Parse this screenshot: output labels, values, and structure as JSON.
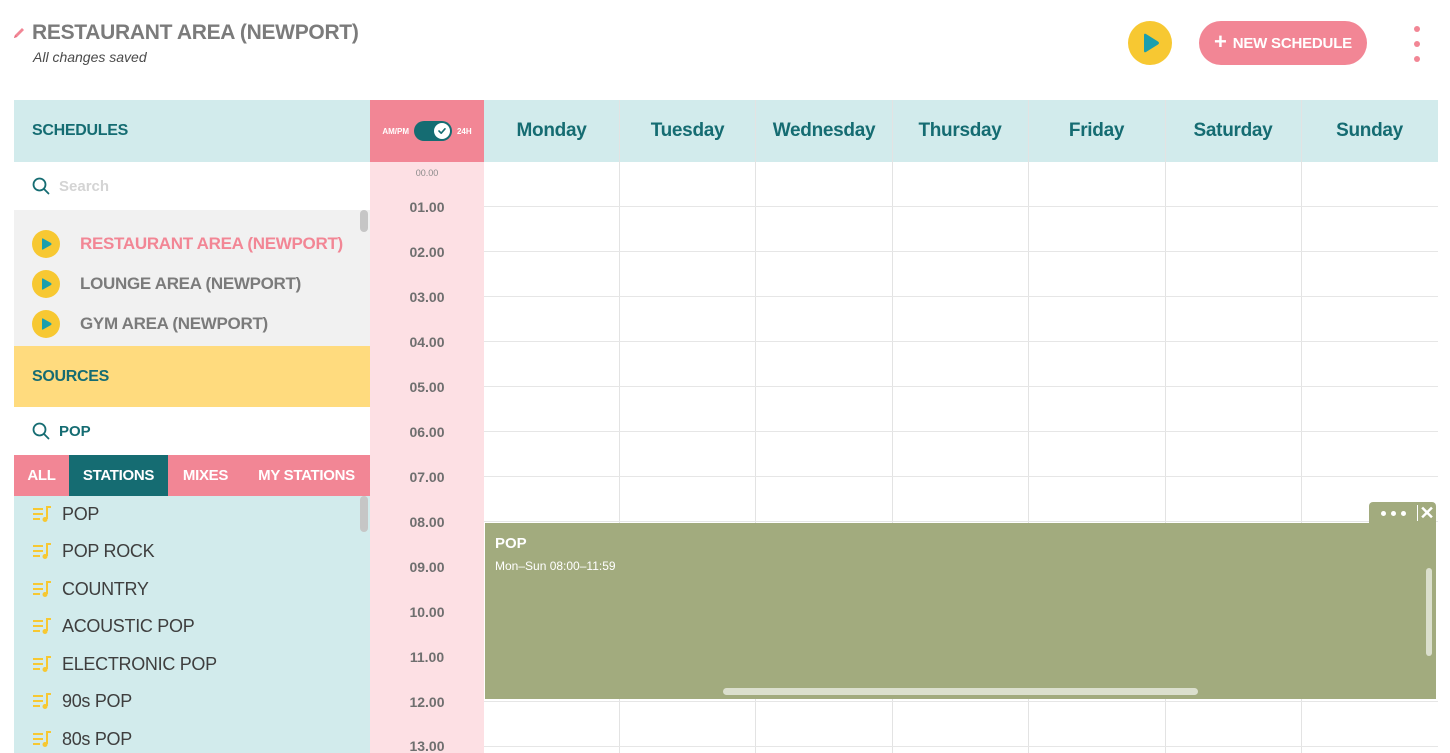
{
  "header": {
    "title": "RESTAURANT AREA (NEWPORT)",
    "status": "All changes saved",
    "new_schedule_label": "NEW SCHEDULE"
  },
  "schedules": {
    "heading": "SCHEDULES",
    "search_placeholder": "Search",
    "items": [
      {
        "label": "RESTAURANT AREA (NEWPORT)",
        "active": true
      },
      {
        "label": "LOUNGE AREA (NEWPORT)",
        "active": false
      },
      {
        "label": "GYM AREA (NEWPORT)",
        "active": false
      }
    ]
  },
  "sources": {
    "heading": "SOURCES",
    "search_value": "POP",
    "tabs": [
      {
        "label": "ALL",
        "selected": false
      },
      {
        "label": "STATIONS",
        "selected": true
      },
      {
        "label": "MIXES",
        "selected": false
      },
      {
        "label": "MY STATIONS",
        "selected": false
      }
    ],
    "stations": [
      "POP",
      "POP ROCK",
      "COUNTRY",
      "ACOUSTIC POP",
      "ELECTRONIC POP",
      "90s POP",
      "80s POP"
    ]
  },
  "time_toggle": {
    "left_label": "AM/PM",
    "right_label": "24H",
    "selected": "24H"
  },
  "hours": [
    "00.00",
    "01.00",
    "02.00",
    "03.00",
    "04.00",
    "05.00",
    "06.00",
    "07.00",
    "08.00",
    "09.00",
    "10.00",
    "11.00",
    "12.00",
    "13.00"
  ],
  "days": [
    "Monday",
    "Tuesday",
    "Wednesday",
    "Thursday",
    "Friday",
    "Saturday",
    "Sunday"
  ],
  "event": {
    "name": "POP",
    "time": "Mon–Sun 08:00–11:59"
  },
  "colors": {
    "accent_pink": "#f28695",
    "teal": "#156c72",
    "light_teal": "#d2ebec",
    "yellow": "#f7c832",
    "sources_yellow": "#ffdb7e",
    "event_olive": "#a2ab7e"
  },
  "icons": {
    "edit": "pencil-icon",
    "play": "play-icon",
    "plus": "plus-icon",
    "menu": "kebab-menu-icon",
    "search": "search-icon",
    "station": "playlist-icon",
    "close": "close-icon",
    "more": "more-dots-icon"
  }
}
